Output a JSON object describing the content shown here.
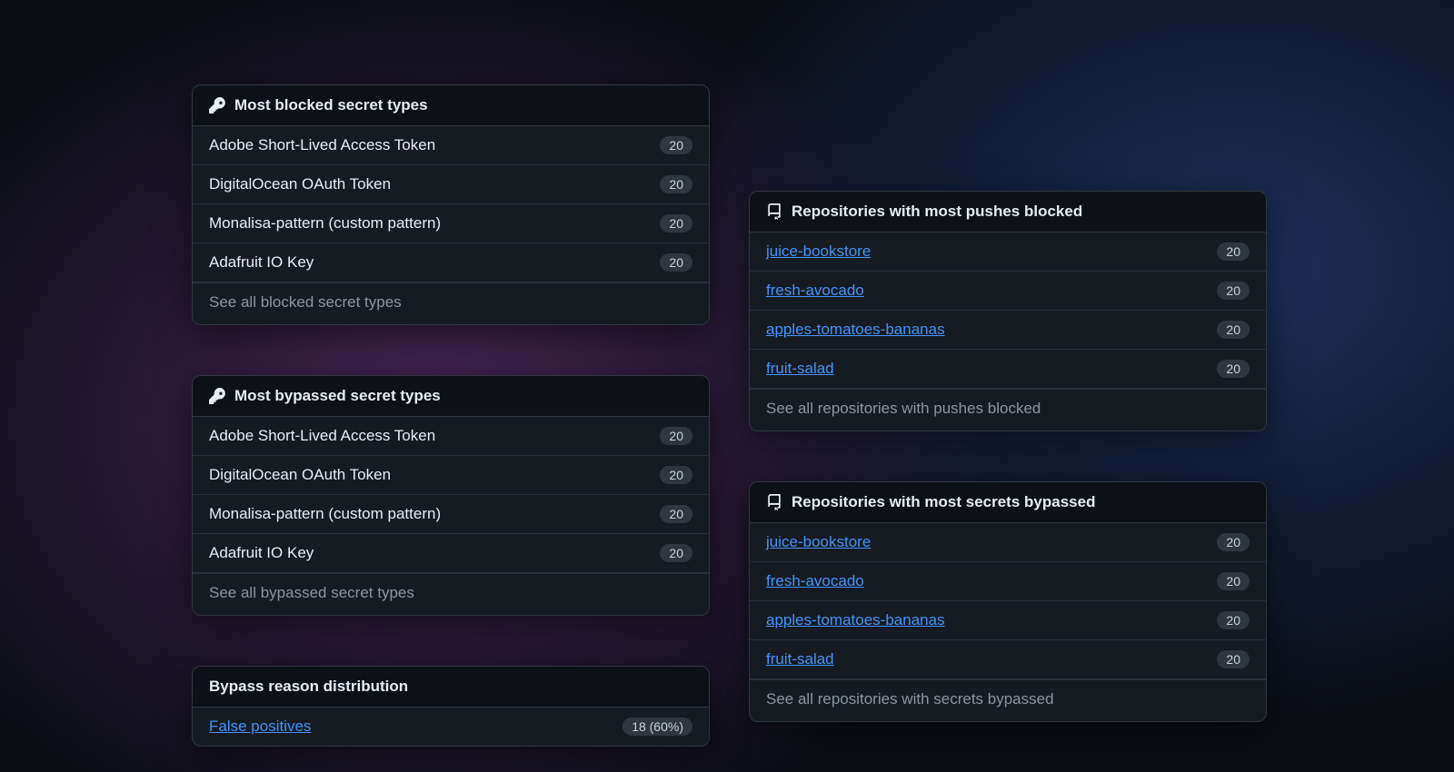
{
  "cards": {
    "blocked_secrets": {
      "title": "Most blocked secret types",
      "items": [
        {
          "label": "Adobe Short-Lived Access Token",
          "count": "20"
        },
        {
          "label": "DigitalOcean OAuth Token",
          "count": "20"
        },
        {
          "label": "Monalisa-pattern (custom pattern)",
          "count": "20"
        },
        {
          "label": "Adafruit IO Key",
          "count": "20"
        }
      ],
      "see_all": "See all blocked secret types"
    },
    "bypassed_secrets": {
      "title": "Most bypassed secret types",
      "items": [
        {
          "label": "Adobe Short-Lived Access Token",
          "count": "20"
        },
        {
          "label": "DigitalOcean OAuth Token",
          "count": "20"
        },
        {
          "label": "Monalisa-pattern (custom pattern)",
          "count": "20"
        },
        {
          "label": "Adafruit IO Key",
          "count": "20"
        }
      ],
      "see_all": "See all bypassed secret types"
    },
    "bypass_reason": {
      "title": "Bypass reason distribution",
      "items": [
        {
          "label": "False positives",
          "count": "18 (60%)"
        }
      ]
    },
    "repos_blocked": {
      "title": "Repositories with most pushes blocked",
      "items": [
        {
          "label": "juice-bookstore",
          "count": "20"
        },
        {
          "label": "fresh-avocado",
          "count": "20"
        },
        {
          "label": "apples-tomatoes-bananas",
          "count": "20"
        },
        {
          "label": "fruit-salad",
          "count": "20"
        }
      ],
      "see_all": "See all repositories with pushes blocked"
    },
    "repos_bypassed": {
      "title": "Repositories with most secrets bypassed",
      "items": [
        {
          "label": "juice-bookstore",
          "count": "20"
        },
        {
          "label": "fresh-avocado",
          "count": "20"
        },
        {
          "label": "apples-tomatoes-bananas",
          "count": "20"
        },
        {
          "label": "fruit-salad",
          "count": "20"
        }
      ],
      "see_all": "See all repositories with secrets bypassed"
    }
  }
}
